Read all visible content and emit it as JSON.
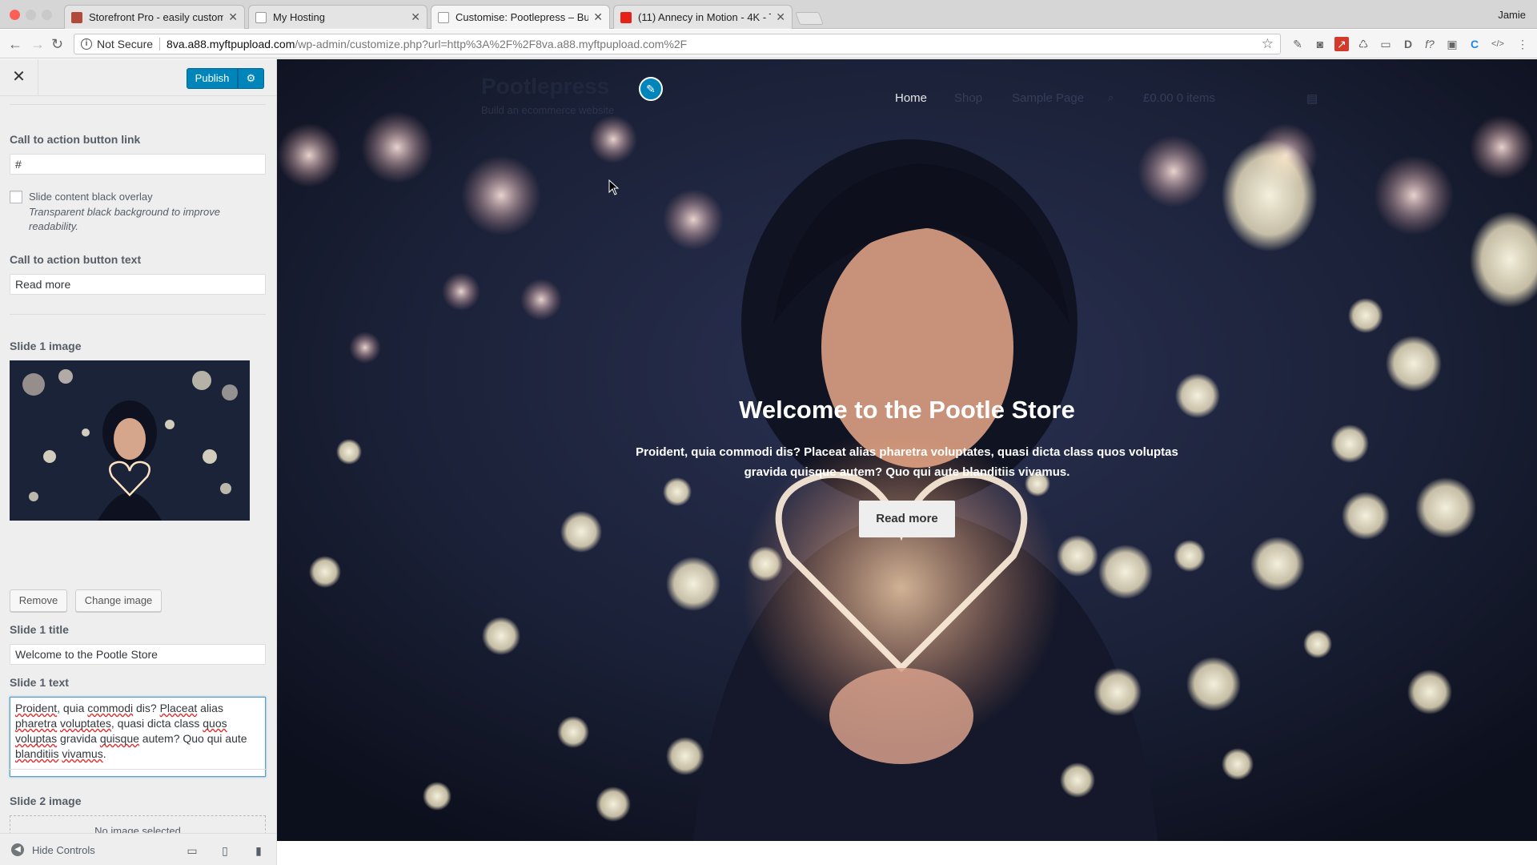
{
  "browser": {
    "tabs": [
      {
        "title": "Storefront Pro - easily custom",
        "favicon_color": "#b24a3b"
      },
      {
        "title": "My Hosting",
        "favicon_color": "#ffffff"
      },
      {
        "title": "Customise: Pootlepress – Buil",
        "favicon_color": "#ffffff"
      },
      {
        "title": "(11) Annecy in Motion - 4K - T",
        "favicon_color": "#e62117"
      }
    ],
    "profile": "Jamie",
    "security_label": "Not Secure",
    "url_host": "8va.a88.myftpupload.com",
    "url_path": "/wp-admin/customize.php?url=http%3A%2F%2F8va.a88.myftpupload.com%2F"
  },
  "customizer": {
    "publish_label": "Publish",
    "cta_link_label": "Call to action button link",
    "cta_link_value": "#",
    "overlay_label": "Slide content black overlay",
    "overlay_desc": "Transparent black background to improve readability.",
    "cta_text_label": "Call to action button text",
    "cta_text_value": "Read more",
    "slide1_image_label": "Slide 1 image",
    "remove_label": "Remove",
    "change_image_label": "Change image",
    "slide1_title_label": "Slide 1 title",
    "slide1_title_value": "Welcome to the Pootle Store",
    "slide1_text_label": "Slide 1 text",
    "slide1_text_parts": [
      "Proident",
      ", quia ",
      "commodi",
      " dis? ",
      "Placeat",
      " alias ",
      "pharetra",
      " ",
      "voluptates",
      ", quasi dicta class ",
      "quos",
      " ",
      "voluptas",
      " gravida ",
      "quisque",
      " autem? Quo qui aute ",
      "blanditiis",
      " ",
      "vivamus",
      "."
    ],
    "slide2_image_label": "Slide 2 image",
    "no_image_label": "No image selected",
    "hide_controls_label": "Hide Controls"
  },
  "preview": {
    "site_title": "Pootlepress",
    "tagline": "Build an ecommerce website",
    "nav": [
      "Home",
      "Shop",
      "Sample Page",
      "£0.00  0 items"
    ],
    "hero_title": "Welcome to the Pootle Store",
    "hero_text": "Proident, quia commodi dis? Placeat alias pharetra voluptates, quasi dicta class quos voluptas gravida quisque autem? Quo qui aute blanditiis vivamus.",
    "hero_button": "Read more"
  },
  "colors": {
    "accent": "#0085ba",
    "sidebar_bg": "#eeeeee"
  }
}
